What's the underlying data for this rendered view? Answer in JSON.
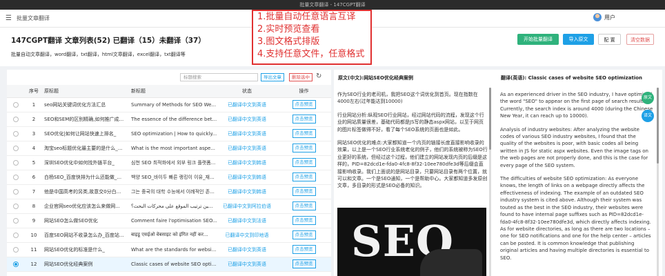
{
  "window": {
    "title": "批量文章翻译 - 147CGPT翻译"
  },
  "topnav": {
    "app_name": "批量文章翻译",
    "user_label": "用户"
  },
  "header": {
    "title": "147CGPT翻译 文章列表(52) 已翻译（15）未翻译（37）",
    "subtitle": "批量自动文章翻译，word翻译，txt翻译，html文章翻译，excel翻译，txt翻译等",
    "buttons": {
      "start": "开始批量翻译",
      "import": "导入原文",
      "config": "配 置",
      "clear": "清空数据"
    }
  },
  "overlay": {
    "lines": [
      "1.批量自动任意语言互译",
      "2.实时预览查看",
      "3.图文格式排版",
      "4.支持任意文件，任意格式"
    ]
  },
  "toolbar": {
    "search_placeholder": "标题搜索",
    "export": "导出文章",
    "delete": "删除选中"
  },
  "table": {
    "headers": {
      "index": "序号",
      "orig": "原标题",
      "new": "新标题",
      "status": "状态",
      "action": "操作"
    },
    "rows": [
      {
        "index": "1",
        "orig": "seo网站关键词优化方法汇总",
        "new": "Summary of Methods for SEO We...",
        "status": "已翻译中文到英语",
        "action": "点击预览",
        "selected": false
      },
      {
        "index": "2",
        "orig": "SEO和SEM的区别精确,如何推广成...",
        "new": "The essence of the difference bet...",
        "status": "已翻译中文到英语",
        "action": "点击预览",
        "selected": false
      },
      {
        "index": "3",
        "orig": "SEO优化|如何让网站快速上排名_",
        "new": "SEO optimization | How to quickly...",
        "status": "已翻译中文到英语",
        "action": "点击预览",
        "selected": false
      },
      {
        "index": "4",
        "orig": "淘宝seo标题优化最主要的是什么_...",
        "new": "What is the most important aspe...",
        "status": "已翻译中文到英语",
        "action": "点击预览",
        "selected": false
      },
      {
        "index": "5",
        "orig": "深圳SEO优化中如何找外链平台_",
        "new": "심천 SEO 최적화에서 외부 링크 플랫폼...",
        "status": "已翻译中文到韩语",
        "action": "点击预览",
        "selected": false
      },
      {
        "index": "6",
        "orig": "白杨SEO_百度快排为什么还能做_...",
        "new": "백양 SEO_바이두 빠른 랭킹이 이유_재...",
        "status": "已翻译中文到韩语",
        "action": "点击预览",
        "selected": false
      },
      {
        "index": "7",
        "orig": "他是中国高考的另类,故意交0分白...",
        "new": "그는 중국의 대학 수능에서 이례적인 존...",
        "status": "已翻译中文到韩语",
        "action": "点击预览",
        "selected": false
      },
      {
        "index": "8",
        "orig": "企业官网seo优化应该怎么来做网...",
        "new": "كيفية تحسين ترتيب الموقع على محركات البحث؟",
        "status": "已翻译中文到阿拉伯语",
        "action": "点击预览",
        "selected": false
      },
      {
        "index": "9",
        "orig": "网站SEO怎么做SEO优化",
        "new": "Comment faire l'optimisation SEO...",
        "status": "已翻译中文到法语",
        "action": "点击预览",
        "selected": false
      },
      {
        "index": "10",
        "orig": "百度SEO网站不收录怎么办_百度站...",
        "new": "बाइडू एसईओ वेबसाइट को इंगित नहीं कर...",
        "status": "已翻译中文到印地语",
        "action": "点击预览",
        "selected": false
      },
      {
        "index": "11",
        "orig": "网站SEO优化的标准是什么_",
        "new": "What are the standards for websi...",
        "status": "已翻译中文到英语",
        "action": "点击预览",
        "selected": false
      },
      {
        "index": "12",
        "orig": "网站SEO优化经典案例",
        "new": "Classic cases of website SEO opti...",
        "status": "已翻译中文到英语",
        "action": "点击预览",
        "selected": true
      }
    ]
  },
  "preview": {
    "orig_heading": "原文(中文):网站SEO优化经典案例",
    "trans_heading": "翻译(英语): Classic cases of website SEO optimization",
    "orig_paragraphs": [
      "作为SEO行业的老司机，我把SEO这个词优化到首页。现在指数在4000左右(过年能达到10000)",
      "行业网站分析:纵观SEO行业网站，经过网站代码的流程，发现这个行业的网站质量很差，基础代码都是JS写的静态aspx网站，以至于网页的图片标签做得不好，看了每个SEO系统的页面也是如此。",
      "网站SEO优化的难点:大家都知道一个内页的链接长度直接影响收录的效果，以上是一个SEO行业系统老化的例子，他们的系统被称为SEO行业更好的系统，但经过这个过程，他们建立的网站发现内页的后缀是这样的，PID=82dcd1e-fda0-4fc8-8f32-10ee780dfe3d等后缀会直接影响收录。我们上面说的是网站目录，只要网站目录有两个位置，就可以和文章。一个是SEO通知，一个是帮助中心。大家都知道多发原创文章，多目录的形式是SEO必备的知识。"
    ],
    "trans_paragraphs": [
      "As an experienced driver in the SEO industry, I have optimized the word \"SEO\" to appear on the first page of search results. Currently, the search index is around 4000 (during the Chinese New Year, it can reach up to 10000).",
      "Analysis of industry websites: After analyzing the website codes of various SEO industry websites, I found that the quality of the websites is poor, with basic codes all being written in JS for static aspx websites. Even the image tags on the web pages are not properly done, and this is the case for every page of the SEO system.",
      "The difficulties of website SEO optimization: As everyone knows, the length of links on a webpage directly affects the effectiveness of indexing. The example of an outdated SEO industry system is cited above. Although their system was touted as the best in the SEO industry, their websites were found to have internal page suffixes such as PID=82dcd1e-fda0-4fc8-8f32-10ee780dfe3d, which directly affects indexing. As for website directories, as long as there are two locations – one for SEO notifications and one for the help center – articles can be posted. It is common knowledge that publishing original articles and having multiple directories is essential to SEO."
    ],
    "image_text": "SEO",
    "float_buttons": {
      "orig": "原文",
      "trans": "译文"
    }
  },
  "colors": {
    "accent": "#1ea0e6",
    "green": "#2fb27c",
    "danger": "#e05050",
    "overlay": "#e03030"
  }
}
